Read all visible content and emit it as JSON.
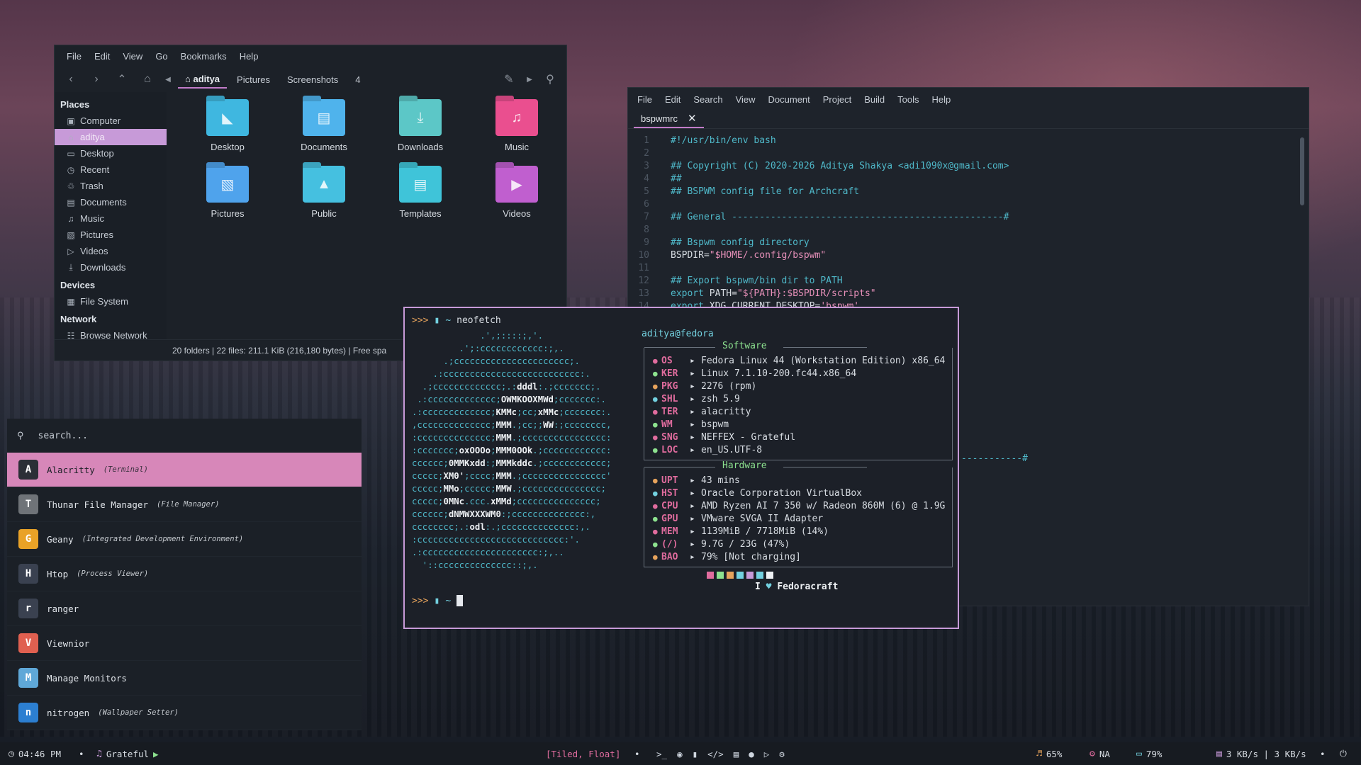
{
  "file_manager": {
    "menu": [
      "File",
      "Edit",
      "View",
      "Go",
      "Bookmarks",
      "Help"
    ],
    "breadcrumbs": [
      "aditya",
      "Pictures",
      "Screenshots",
      "4"
    ],
    "sidebar": {
      "places_heading": "Places",
      "places": [
        {
          "label": "Computer",
          "icon": "computer-icon"
        },
        {
          "label": "aditya",
          "icon": "home-icon",
          "selected": true
        },
        {
          "label": "Desktop",
          "icon": "desktop-icon"
        },
        {
          "label": "Recent",
          "icon": "recent-icon"
        },
        {
          "label": "Trash",
          "icon": "trash-icon"
        },
        {
          "label": "Documents",
          "icon": "documents-icon"
        },
        {
          "label": "Music",
          "icon": "music-icon"
        },
        {
          "label": "Pictures",
          "icon": "pictures-icon"
        },
        {
          "label": "Videos",
          "icon": "videos-icon"
        },
        {
          "label": "Downloads",
          "icon": "downloads-icon"
        }
      ],
      "devices_heading": "Devices",
      "devices": [
        {
          "label": "File System",
          "icon": "drive-icon"
        }
      ],
      "network_heading": "Network",
      "network": [
        {
          "label": "Browse Network",
          "icon": "network-icon"
        }
      ]
    },
    "folders": [
      {
        "label": "Desktop",
        "color": "#3fb7e0"
      },
      {
        "label": "Documents",
        "color": "#4fb3ec"
      },
      {
        "label": "Downloads",
        "color": "#5cc7c7"
      },
      {
        "label": "Music",
        "color": "#ea4f8f"
      },
      {
        "label": "Pictures",
        "color": "#4fa3ec"
      },
      {
        "label": "Public",
        "color": "#45c0e0"
      },
      {
        "label": "Templates",
        "color": "#3fc4d9"
      },
      {
        "label": "Videos",
        "color": "#c05fcf"
      }
    ],
    "status": "20 folders  |  22 files: 211.1 KiB (216,180 bytes)  |  Free spa"
  },
  "editor": {
    "menu": [
      "File",
      "Edit",
      "Search",
      "View",
      "Document",
      "Project",
      "Build",
      "Tools",
      "Help"
    ],
    "tab_label": "bspwmrc",
    "lines": [
      {
        "n": "1",
        "parts": [
          {
            "c": "cm",
            "t": "#!/usr/bin/env bash"
          }
        ]
      },
      {
        "n": "2",
        "parts": []
      },
      {
        "n": "3",
        "parts": [
          {
            "c": "cm",
            "t": "## Copyright (C) 2020-2026 Aditya Shakya <adi1090x@gmail.com>"
          }
        ]
      },
      {
        "n": "4",
        "parts": [
          {
            "c": "cm",
            "t": "##"
          }
        ]
      },
      {
        "n": "5",
        "parts": [
          {
            "c": "cm",
            "t": "## BSPWM config file for Archcraft"
          }
        ]
      },
      {
        "n": "6",
        "parts": []
      },
      {
        "n": "7",
        "parts": [
          {
            "c": "cm",
            "t": "## General -------------------------------------------------#"
          }
        ]
      },
      {
        "n": "8",
        "parts": []
      },
      {
        "n": "9",
        "parts": [
          {
            "c": "cm",
            "t": "## Bspwm config directory"
          }
        ]
      },
      {
        "n": "10",
        "parts": [
          {
            "c": "pl",
            "t": "BSPDIR="
          },
          {
            "c": "str",
            "t": "\"$HOME/.config/bspwm\""
          }
        ]
      },
      {
        "n": "11",
        "parts": []
      },
      {
        "n": "12",
        "parts": [
          {
            "c": "cm",
            "t": "## Export bspwm/bin dir to PATH"
          }
        ]
      },
      {
        "n": "13",
        "parts": [
          {
            "c": "kw",
            "t": "export "
          },
          {
            "c": "pl",
            "t": "PATH="
          },
          {
            "c": "str",
            "t": "\"${PATH}:$BSPDIR/scripts\""
          }
        ]
      },
      {
        "n": "14",
        "parts": [
          {
            "c": "kw",
            "t": "export "
          },
          {
            "c": "pl",
            "t": "XDG_CURRENT_DESKTOP="
          },
          {
            "c": "str",
            "t": "'bspwm'"
          }
        ]
      }
    ],
    "hidden_line_fragment": "-----------#"
  },
  "terminal": {
    "command": "neofetch",
    "prompt_symbol": ">>>",
    "prompt_dir": "~",
    "ascii_lines": [
      "             .',;::::;,'.",
      "         .';:cccccccccccc:;,.",
      "      .;cccccccccccccccccccccc;.",
      "    .:cccccccccccccccccccccccccc:.",
      "  .;ccccccccccccc;.:dddl:.;ccccccc;.",
      " .:ccccccccccccc;OWMKOOXMWd;ccccccc:.",
      ".:ccccccccccccc;KMMc;cc;xMMc;ccccccc:.",
      ",cccccccccccccc;MMM.;cc;;WW:;cccccccc,",
      ":cccccccccccccc;MMM.;cccccccccccccccc:",
      ":ccccccc;oxOOOo;MMM0OOk.;cccccccccccc:",
      "cccccc;0MMKxdd:;MMMkddc.;cccccccccccc;",
      "ccccc;XM0';cccc;MMM.;cccccccccccccccc'",
      "ccccc;MMo;ccccc;MMW.;ccccccccccccccc;",
      "ccccc;0MNc.ccc.xMMd;ccccccccccccccc;",
      "cccccc;dNMWXXXWM0:;cccccccccccccc:,",
      "cccccccc;.:odl:.;cccccccccccccc:,.",
      ":cccccccccccccccccccccccccccc:'.",
      ".:cccccccccccccccccccccc:;,..",
      "  '::cccccccccccccc::;,."
    ],
    "user_host": "aditya@fedora",
    "software_title": "Software",
    "software": [
      {
        "key": "OS",
        "value": "Fedora Linux 44 (Workstation Edition) x86_64",
        "dot": "#e06c9e"
      },
      {
        "key": "KER",
        "value": "Linux 7.1.10-200.fc44.x86_64",
        "dot": "#8de28f"
      },
      {
        "key": "PKG",
        "value": "2276 (rpm)",
        "dot": "#e6a35c"
      },
      {
        "key": "SHL",
        "value": "zsh 5.9",
        "dot": "#73d1e0"
      },
      {
        "key": "TER",
        "value": "alacritty",
        "dot": "#e06c9e"
      },
      {
        "key": "WM",
        "value": "bspwm",
        "dot": "#8de28f"
      },
      {
        "key": "SNG",
        "value": "NEFFEX - Grateful",
        "dot": "#e06c9e"
      },
      {
        "key": "LOC",
        "value": "en_US.UTF-8",
        "dot": "#8de28f"
      }
    ],
    "hardware_title": "Hardware",
    "hardware": [
      {
        "key": "UPT",
        "value": "43 mins",
        "dot": "#e6a35c"
      },
      {
        "key": "HST",
        "value": "Oracle Corporation VirtualBox",
        "dot": "#73d1e0"
      },
      {
        "key": "CPU",
        "value": "AMD Ryzen AI 7 350 w/ Radeon 860M (6) @ 1.9G",
        "dot": "#e06c9e"
      },
      {
        "key": "GPU",
        "value": "VMware SVGA II Adapter",
        "dot": "#8de28f"
      },
      {
        "key": "MEM",
        "value": "1139MiB / 7718MiB (14%)",
        "dot": "#e06c9e"
      },
      {
        "key": "(/)",
        "value": "9.7G / 23G (47%)",
        "dot": "#8de28f"
      },
      {
        "key": "BAO",
        "value": "79% [Not charging]",
        "dot": "#e6a35c"
      }
    ],
    "swatches": [
      "#1c2028",
      "#e06c9e",
      "#8de28f",
      "#e6a35c",
      "#73d1e0",
      "#c79ad8",
      "#73d1e0",
      "#eef1f4"
    ],
    "love_prefix": "I",
    "love_name": "Fedoracraft"
  },
  "launcher": {
    "placeholder": "search...",
    "items": [
      {
        "name": "Alacritty",
        "desc": "(Terminal)",
        "icon_color": "#2b2f36",
        "glyph": "A",
        "selected": true
      },
      {
        "name": "Thunar File Manager",
        "desc": "(File Manager)",
        "icon_color": "#6f7378",
        "glyph": "T"
      },
      {
        "name": "Geany",
        "desc": "(Integrated Development Environment)",
        "icon_color": "#e9a227",
        "glyph": "G"
      },
      {
        "name": "Htop",
        "desc": "(Process Viewer)",
        "icon_color": "#3a4150",
        "glyph": "H"
      },
      {
        "name": "ranger",
        "desc": "",
        "icon_color": "#3a4150",
        "glyph": "r"
      },
      {
        "name": "Viewnior",
        "desc": "",
        "icon_color": "#e06050",
        "glyph": "V"
      },
      {
        "name": "Manage Monitors",
        "desc": "",
        "icon_color": "#5fa8d8",
        "glyph": "M"
      },
      {
        "name": "nitrogen",
        "desc": "(Wallpaper Setter)",
        "icon_color": "#2c7fd1",
        "glyph": "n"
      }
    ]
  },
  "bar": {
    "time": "04:46 PM",
    "song": "Grateful",
    "layout": "[Tiled, Float]",
    "volume": "65%",
    "network": "NA",
    "battery": "79%",
    "traffic": "3 KB/s | 3 KB/s"
  }
}
